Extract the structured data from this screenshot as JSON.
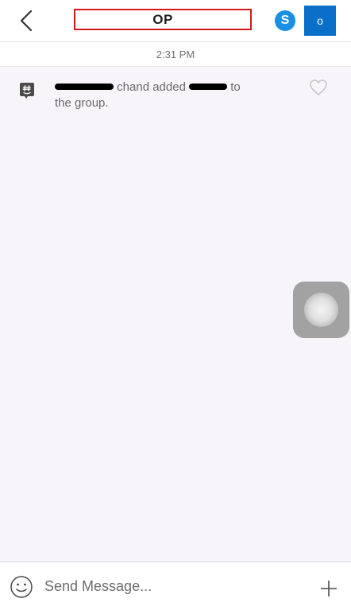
{
  "header": {
    "title": "OP",
    "back_icon": "chevron-left-icon",
    "skype_icon": "skype-icon",
    "skype_glyph": "S",
    "outlook_icon": "outlook-icon",
    "outlook_glyph": "o"
  },
  "timestamp": "2:31 PM",
  "system_message": {
    "icon": "groupme-icon",
    "part1": "chand added",
    "part2": "to",
    "line2": "the group.",
    "like_icon": "heart-icon"
  },
  "composer": {
    "placeholder": "Send Message...",
    "emoji_icon": "emoji-icon",
    "add_icon": "plus-icon"
  },
  "colors": {
    "title_outline": "#d21a1a",
    "skype_blue": "#1a8fe3",
    "outlook_blue": "#0a6fc9",
    "background": "#f8f5fa"
  }
}
